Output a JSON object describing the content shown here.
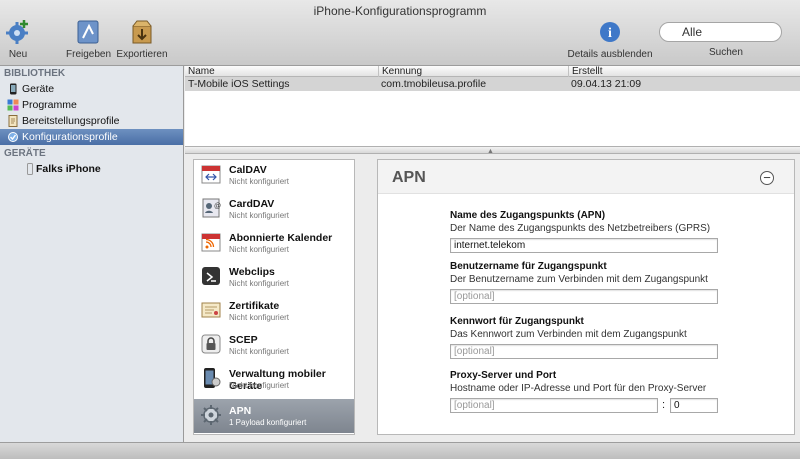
{
  "window": {
    "title": "iPhone-Konfigurationsprogramm"
  },
  "toolbar": {
    "new_label": "Neu",
    "share_label": "Freigeben",
    "export_label": "Exportieren",
    "details_label": "Details ausblenden",
    "search_label": "Suchen",
    "search_value": "Alle"
  },
  "sidebar": {
    "library_header": "BIBLIOTHEK",
    "library_items": [
      {
        "label": "Geräte",
        "icon": "iphone-icon"
      },
      {
        "label": "Programme",
        "icon": "apps-icon"
      },
      {
        "label": "Bereitstellungsprofile",
        "icon": "provisioning-icon"
      },
      {
        "label": "Konfigurationsprofile",
        "icon": "gear-check-icon",
        "selected": true
      }
    ],
    "devices_header": "GERÄTE",
    "devices": [
      {
        "label": "Falks iPhone",
        "icon": "phone-outline-icon"
      }
    ]
  },
  "table": {
    "columns": [
      "Name",
      "Kennung",
      "Erstellt"
    ],
    "rows": [
      [
        "T-Mobile iOS Settings",
        "com.tmobileusa.profile",
        "09.04.13 21:09"
      ]
    ]
  },
  "payloads": [
    {
      "title": "CalDAV",
      "subtitle": "Nicht konfiguriert",
      "icon": "calendar-icon"
    },
    {
      "title": "CardDAV",
      "subtitle": "Nicht konfiguriert",
      "icon": "contacts-icon"
    },
    {
      "title": "Abonnierte Kalender",
      "subtitle": "Nicht konfiguriert",
      "icon": "rss-calendar-icon"
    },
    {
      "title": "Webclips",
      "subtitle": "Nicht konfiguriert",
      "icon": "webclip-icon"
    },
    {
      "title": "Zertifikate",
      "subtitle": "Nicht konfiguriert",
      "icon": "certificate-icon"
    },
    {
      "title": "SCEP",
      "subtitle": "Nicht konfiguriert",
      "icon": "lock-icon"
    },
    {
      "title": "Verwaltung mobiler Geräte",
      "subtitle": "Nicht konfiguriert",
      "icon": "mobile-management-icon"
    },
    {
      "title": "APN",
      "subtitle": "1 Payload konfiguriert",
      "icon": "gear-icon",
      "selected": true
    }
  ],
  "detail": {
    "title": "APN",
    "fields": [
      {
        "label": "Name des Zugangspunkts (APN)",
        "description": "Der Name des Zugangspunkts des Netzbetreibers (GPRS)",
        "value": "internet.telekom",
        "placeholder": ""
      },
      {
        "label": "Benutzername für Zugangspunkt",
        "description": "Der Benutzername zum Verbinden mit dem Zugangspunkt",
        "value": "",
        "placeholder": "[optional]"
      },
      {
        "label": "Kennwort für Zugangspunkt",
        "description": "Das Kennwort zum Verbinden mit dem Zugangspunkt",
        "value": "",
        "placeholder": "[optional]"
      }
    ],
    "proxy": {
      "label": "Proxy-Server und Port",
      "description": "Hostname oder IP-Adresse und Port für den Proxy-Server",
      "host_placeholder": "[optional]",
      "separator": ":",
      "port_value": "0"
    }
  }
}
